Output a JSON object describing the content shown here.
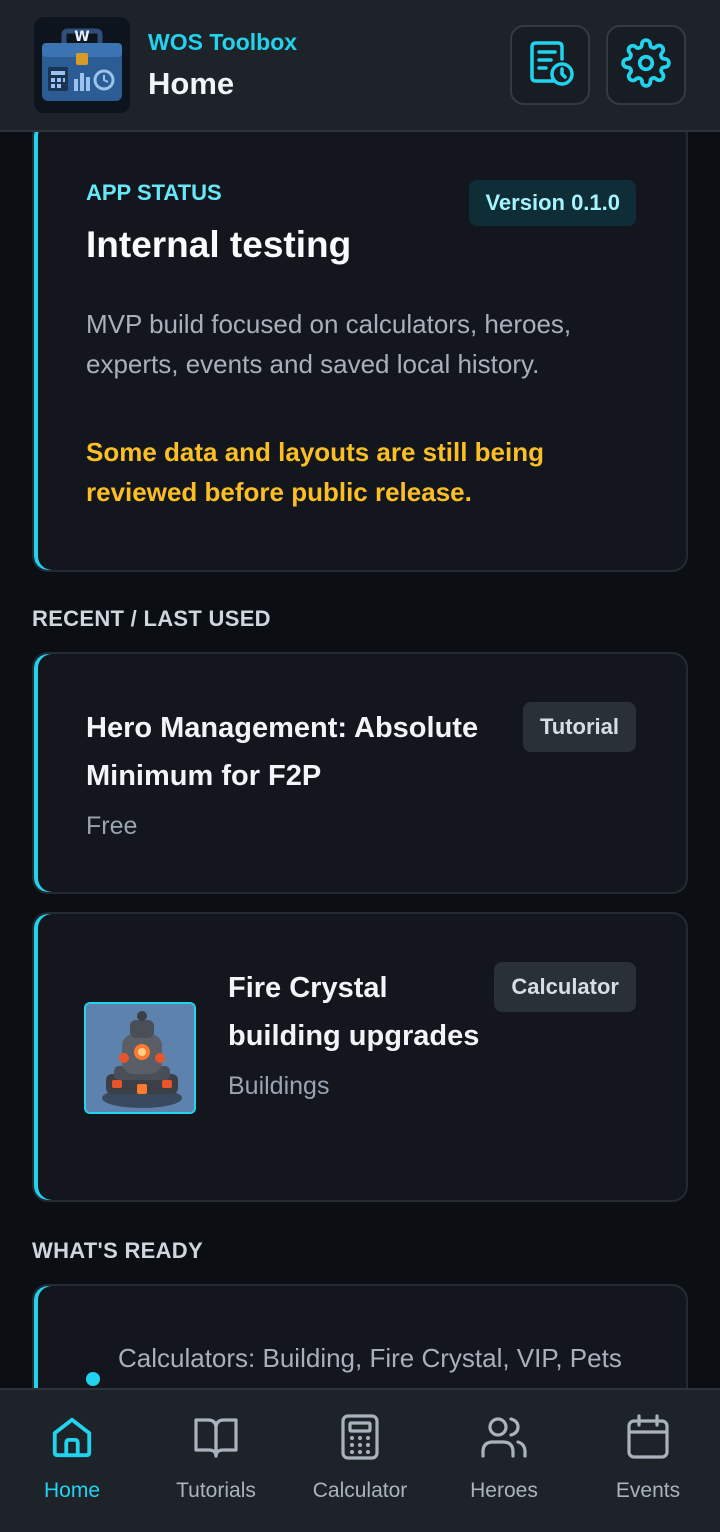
{
  "header": {
    "app_name": "WOS Toolbox",
    "page_title": "Home",
    "logo_letter": "W"
  },
  "status_card": {
    "kicker": "APP STATUS",
    "version": "Version 0.1.0",
    "title": "Internal testing",
    "description": "MVP build focused on calculators, heroes, experts, events and saved local history.",
    "warning": "Some data and layouts are still being reviewed before public release."
  },
  "recent": {
    "section_label": "RECENT / LAST USED",
    "items": [
      {
        "title": "Hero Management: Absolute Minimum for F2P",
        "subtitle": "Free",
        "tag": "Tutorial"
      },
      {
        "title": "Fire Crystal building upgrades",
        "subtitle": "Buildings",
        "tag": "Calculator",
        "icon": "fire-crystal-building-icon"
      }
    ]
  },
  "ready": {
    "section_label": "WHAT'S READY",
    "items": [
      {
        "text": "Calculators: Building, Fire Crystal, VIP, Pets and Experts"
      }
    ]
  },
  "nav": {
    "items": [
      {
        "label": "Home",
        "icon": "home-icon",
        "active": true
      },
      {
        "label": "Tutorials",
        "icon": "book-icon",
        "active": false
      },
      {
        "label": "Calculator",
        "icon": "calculator-icon",
        "active": false
      },
      {
        "label": "Heroes",
        "icon": "users-icon",
        "active": false
      },
      {
        "label": "Events",
        "icon": "calendar-icon",
        "active": false
      }
    ]
  },
  "colors": {
    "accent": "#22d3ee",
    "warning": "#fbbf24",
    "background": "#0b0e13",
    "card": "#13171d"
  }
}
